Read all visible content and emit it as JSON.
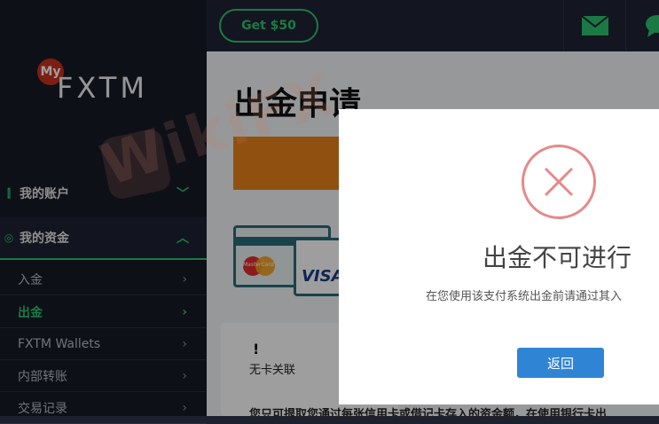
{
  "sidebar": {
    "logo_badge": "My",
    "logo_text": "FXTM",
    "sections": [
      {
        "label": "我的账户",
        "expanded": false
      },
      {
        "label": "我的资金",
        "expanded": true
      }
    ],
    "sub_items": [
      {
        "label": "入金",
        "active": false
      },
      {
        "label": "出金",
        "active": true
      },
      {
        "label": "FXTM Wallets",
        "active": false
      },
      {
        "label": "内部转账",
        "active": false
      },
      {
        "label": "交易记录",
        "active": false
      }
    ]
  },
  "topbar": {
    "promo_button": "Get $50",
    "icons": [
      "mail-icon",
      "chat-icon"
    ]
  },
  "main": {
    "page_title": "出金申请",
    "card_brands": [
      "MasterCard",
      "VISA"
    ],
    "notice_mark": "!",
    "notice_text": "无卡关联",
    "bottom_text": "您只可提取您通过每张信用卡或借记卡存入的资金额，在使用银行卡出"
  },
  "modal": {
    "icon": "error-x-icon",
    "title": "出金不可进行",
    "message": "在您使用该支付系统出金前请通过其入",
    "button": "返回"
  },
  "watermark": "WikiFX",
  "colors": {
    "accent_green": "#2cc46f",
    "sidebar_bg": "#171b28",
    "orange": "#e8841b",
    "modal_button": "#2f85d3",
    "error_red": "#e58a8a"
  }
}
